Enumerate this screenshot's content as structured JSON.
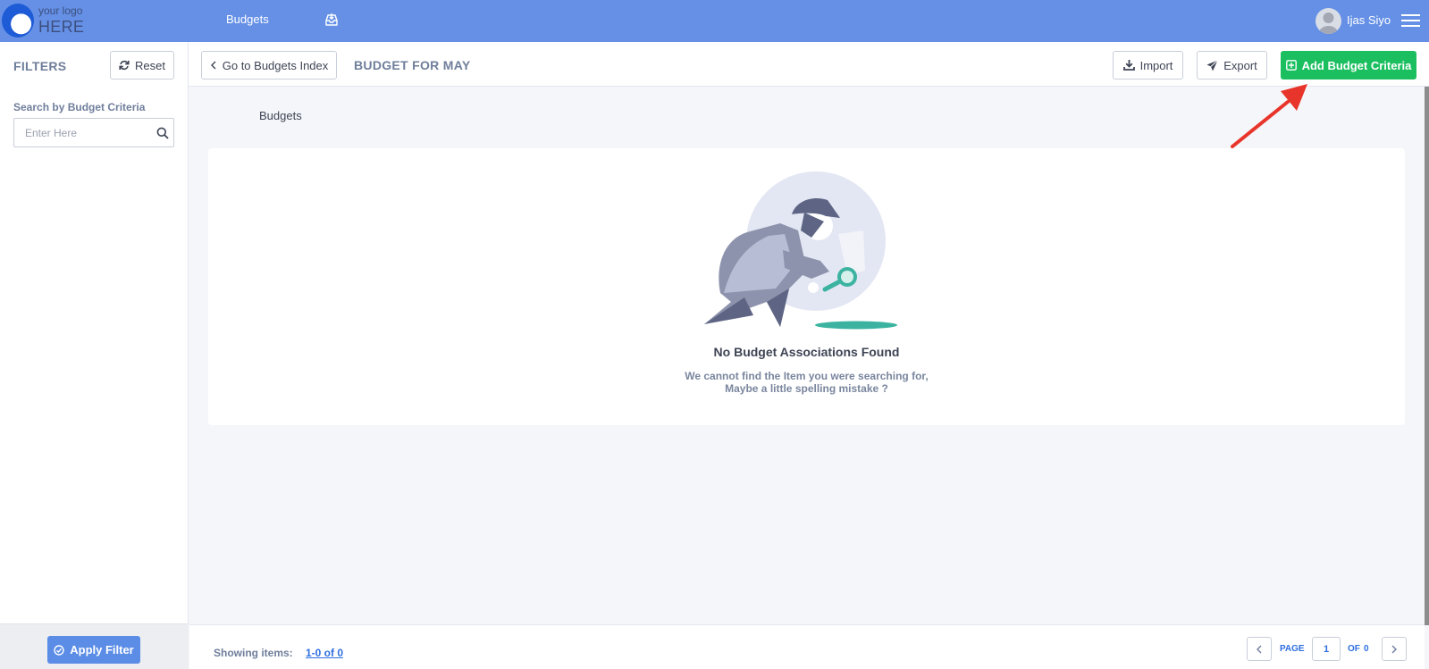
{
  "topbar": {
    "logo_top": "your logo",
    "logo_bottom": "HERE",
    "nav_budgets": "Budgets",
    "user_name": "Ijas Siyo",
    "icons": [
      "inbox-icon",
      "avatar",
      "hamburger-menu-icon"
    ]
  },
  "sidebar": {
    "title": "FILTERS",
    "reset_label": "Reset",
    "search_label": "Search by Budget Criteria",
    "search_placeholder": "Enter Here",
    "apply_label": "Apply Filter"
  },
  "header": {
    "back_label": "Go to Budgets Index",
    "page_title": "BUDGET FOR MAY",
    "import_label": "Import",
    "export_label": "Export",
    "add_label": "Add Budget Criteria"
  },
  "main": {
    "breadcrumb": "Budgets",
    "empty_title": "No Budget Associations Found",
    "empty_line1": "We cannot find the Item you were searching for,",
    "empty_line2": "Maybe a little spelling mistake ?"
  },
  "footer": {
    "showing_label": "Showing items:",
    "showing_value": "1-0 of 0",
    "page_label": "PAGE",
    "page_current": "1",
    "of_label": "OF",
    "page_total": "0"
  },
  "colors": {
    "topbar": "#6590e6",
    "add_button": "#1bbf5f",
    "apply_button": "#5b8ce6",
    "link": "#2f6fe0",
    "annotation_arrow": "#e8352b"
  }
}
